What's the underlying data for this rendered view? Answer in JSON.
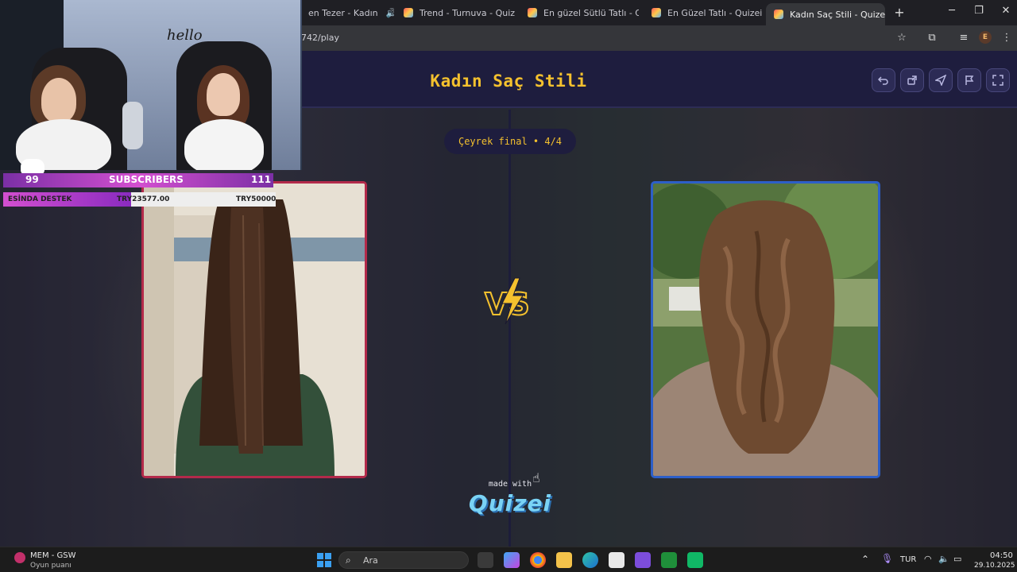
{
  "browser": {
    "tabs": [
      {
        "label": "en Tezer - Kadın",
        "active": false,
        "audio": true
      },
      {
        "label": "Trend - Turnuva - Quizei",
        "active": false
      },
      {
        "label": "En güzel Sütlü Tatlı - Qui",
        "active": false
      },
      {
        "label": "En Güzel Tatlı - Quizei",
        "active": false
      },
      {
        "label": "Kadın Saç Stili - Quizei",
        "active": true
      }
    ],
    "url": "742/play",
    "profile_initial": "E"
  },
  "quiz": {
    "title": "Kadın Saç Stili",
    "round_label": "Çeyrek final • 4/4",
    "vs_label": "VS",
    "made_with": "made with",
    "brand": "Quizei",
    "left_choice": {
      "image": "straight-long-brown-hair"
    },
    "right_choice": {
      "image": "wavy-long-brown-hair"
    },
    "header_buttons": [
      "undo-icon",
      "share-icon",
      "send-icon",
      "flag-icon",
      "fullscreen-icon"
    ]
  },
  "stream_overlay": {
    "subscribers_left": "99",
    "subscribers_label": "SUBSCRIBERS",
    "subscribers_right": "111",
    "donation_label": "ESİNDA DESTEK",
    "donation_current": "TRY23577.00",
    "donation_goal": "TRY50000",
    "donation_progress": 0.47
  },
  "taskbar": {
    "app_name": "MEM - GSW",
    "app_subtitle": "Oyun puanı",
    "search_placeholder": "Ara",
    "language": "TUR",
    "time": "04:50",
    "date": "29.10.2025"
  },
  "colors": {
    "accent_yellow": "#f4c12e",
    "left_border": "#b32a4a",
    "right_border": "#2d5fc8",
    "header_bg": "#1e1d3e"
  }
}
